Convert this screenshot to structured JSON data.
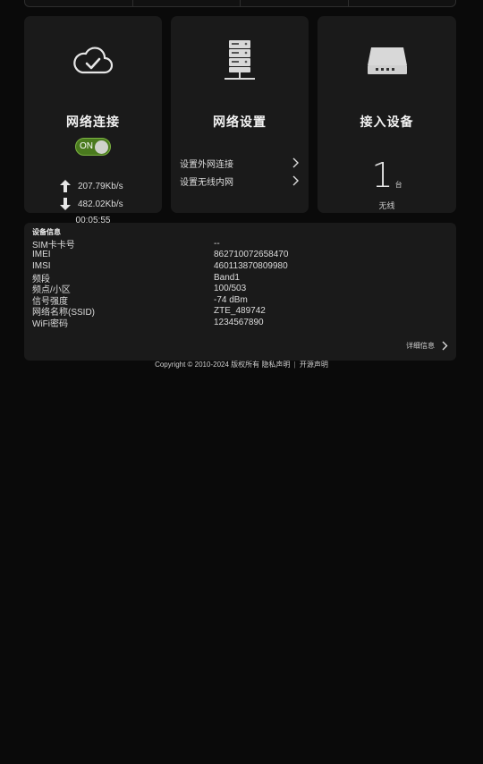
{
  "network_card": {
    "title": "网络连接",
    "icon": "cloud-check-icon",
    "toggle_label": "ON",
    "upload_rate": "207.79Kb/s",
    "download_rate": "482.02Kb/s",
    "uptime": "00:05:55"
  },
  "settings_card": {
    "title": "网络设置",
    "icon": "server-icon",
    "links": [
      "设置外网连接",
      "设置无线内网"
    ]
  },
  "devices_card": {
    "title": "接入设备",
    "icon": "router-icon",
    "count": "1",
    "unit": "台",
    "type": "无线"
  },
  "device_info": {
    "title": "设备信息",
    "rows": [
      {
        "label": "SIM卡卡号",
        "value": "--"
      },
      {
        "label": "IMEI",
        "value": "862710072658470"
      },
      {
        "label": "IMSI",
        "value": "460113870809980"
      },
      {
        "label": "频段",
        "value": "Band1"
      },
      {
        "label": "频点/小区",
        "value": "100/503"
      },
      {
        "label": "信号强度",
        "value": "-74 dBm"
      },
      {
        "label": "网络名称(SSID)",
        "value": "ZTE_489742"
      },
      {
        "label": "WiFi密码",
        "value": "1234567890"
      }
    ],
    "detail_link": "详细信息"
  },
  "footer": {
    "copyright": "Copyright © 2010-2024 版权所有",
    "privacy": "隐私声明",
    "separator": "|",
    "opensource": "开源声明"
  },
  "colors": {
    "background": "#0a0a0a",
    "card": "#1a1a1a",
    "toggle_on": "#4a7a1e"
  }
}
